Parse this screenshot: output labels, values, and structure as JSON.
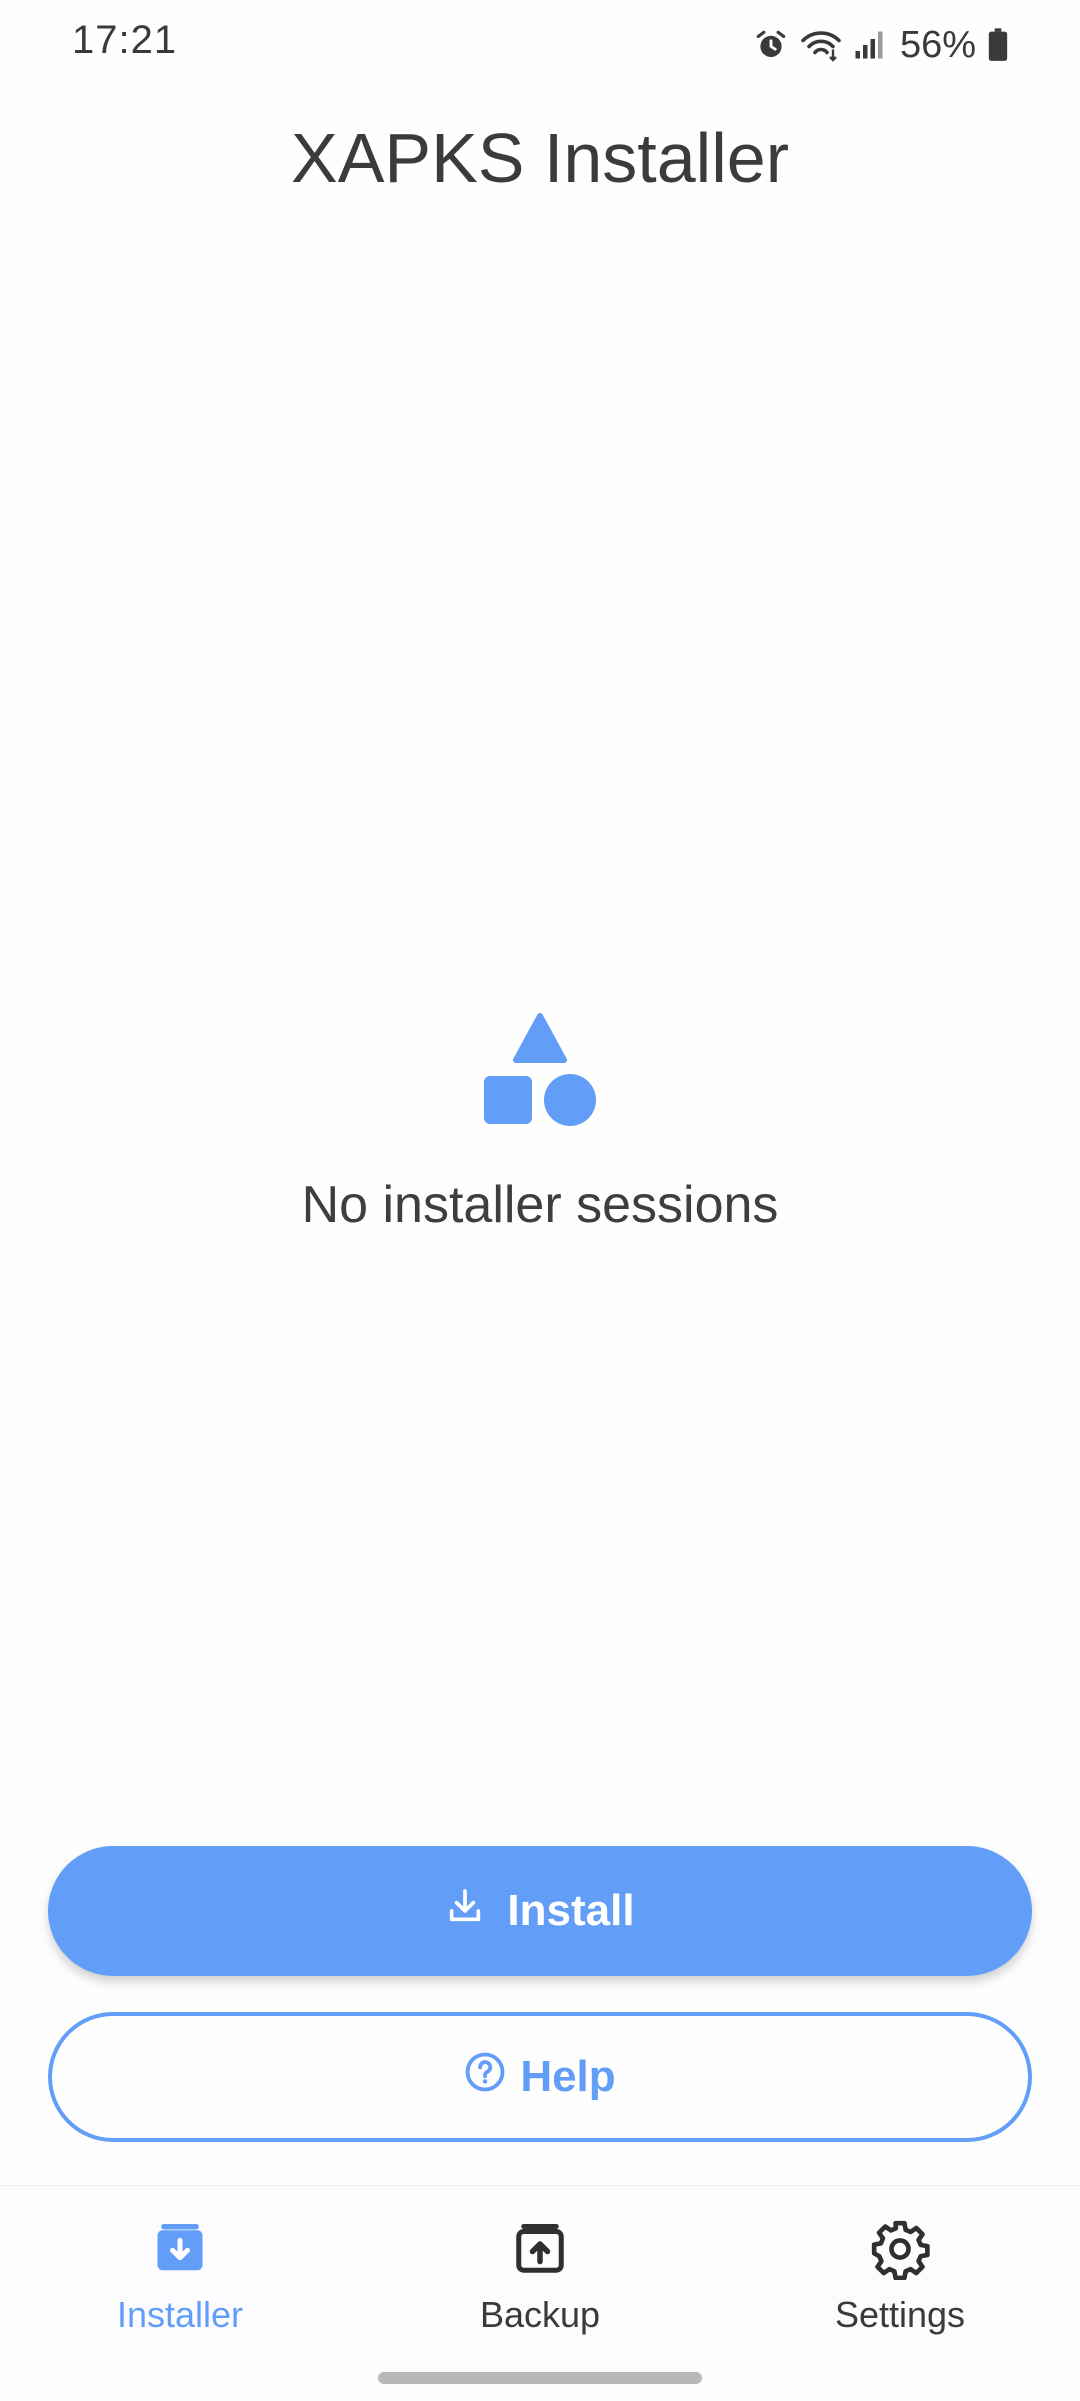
{
  "status_bar": {
    "time": "17:21",
    "battery": "56%",
    "icons": [
      "alarm-icon",
      "wifi-icon",
      "signal-icon",
      "battery-icon"
    ]
  },
  "app": {
    "title": "XAPKS Installer"
  },
  "empty_state": {
    "icon": "shapes-icon",
    "text": "No installer sessions"
  },
  "actions": {
    "install_label": "Install",
    "help_label": "Help"
  },
  "bottom_nav": {
    "items": [
      {
        "label": "Installer",
        "icon": "installer-icon",
        "active": true
      },
      {
        "label": "Backup",
        "icon": "backup-icon",
        "active": false
      },
      {
        "label": "Settings",
        "icon": "gear-icon",
        "active": false
      }
    ]
  },
  "colors": {
    "accent": "#629ef8",
    "text": "#3f3f3f",
    "background": "#fefefe"
  }
}
